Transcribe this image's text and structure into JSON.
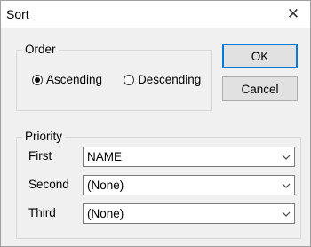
{
  "window": {
    "title": "Sort",
    "close_glyph": "✕"
  },
  "order": {
    "legend": "Order",
    "ascending_label": "Ascending",
    "descending_label": "Descending",
    "selected": "ascending"
  },
  "buttons": {
    "ok": "OK",
    "cancel": "Cancel"
  },
  "priority": {
    "legend": "Priority",
    "first_label": "First",
    "first_value": "NAME",
    "second_label": "Second",
    "second_value": "(None)",
    "third_label": "Third",
    "third_value": "(None)"
  },
  "icons": {
    "dropdown": "chevron-down-icon",
    "close": "close-icon"
  },
  "colors": {
    "default_button_border": "#0078d7",
    "dialog_bg": "#f0f0f0"
  }
}
